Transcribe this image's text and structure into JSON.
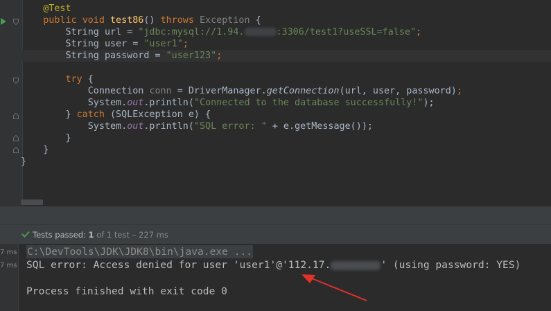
{
  "editor": {
    "lines": [
      {
        "ann": "@Test"
      },
      {
        "kw1": "public ",
        "kw2": "void ",
        "fn": "test86",
        "punct1": "() ",
        "kw3": "throws ",
        "exc": "Exception",
        "punct2": " {"
      },
      {
        "type": "String ",
        "name": "url = ",
        "s1": "\"jdbc:mysql://1.94.",
        "s2": ":3306/test1?useSSL=false\"",
        "end": ";"
      },
      {
        "type": "String ",
        "name": "user = ",
        "str": "\"user1\"",
        "end": ";"
      },
      {
        "type": "String ",
        "name": "password = ",
        "str": "\"user123\"",
        "end": ";"
      },
      {
        "text": ""
      },
      {
        "kw": "try",
        "rest": " {"
      },
      {
        "type": "Connection ",
        "var": "conn",
        "eq": " = DriverManager.",
        "method": "getConnection",
        "args": "(url, user, password)",
        "end": ";"
      },
      {
        "cls": "System.",
        "field": "out",
        "call": ".println(",
        "str": "\"Connected to the database successfully!\"",
        "end": ");"
      },
      {
        "p1": "} ",
        "kw": "catch",
        "rest": " (SQLException e) {"
      },
      {
        "cls": "System.",
        "field": "out",
        "call": ".println(",
        "str": "\"SQL error: \"",
        "rest": " + e.getMessage()",
        "end": ");"
      },
      {
        "text": "}"
      },
      {
        "text": "}"
      },
      {
        "text": "}"
      }
    ]
  },
  "status": {
    "label": "Tests passed: ",
    "passed": "1",
    "rest": " of 1 test – 227 ms"
  },
  "console": {
    "ms1": "7 ms",
    "ms2": "7 ms",
    "line1": "C:\\DevTools\\JDK\\JDK8\\bin\\java.exe ...",
    "line2a": "SQL error: Access denied for user 'user1'@'112.17.",
    "line2b": "' (using password: YES)",
    "line3": "Process finished with exit code 0"
  },
  "colors": {
    "background": "#2b2b2b",
    "keyword": "#cc7832",
    "string": "#6a8759",
    "annotation": "#bbb529",
    "method": "#ffc66d",
    "field": "#9876aa",
    "arrow": "#e0312a",
    "passed": "#499c54"
  }
}
